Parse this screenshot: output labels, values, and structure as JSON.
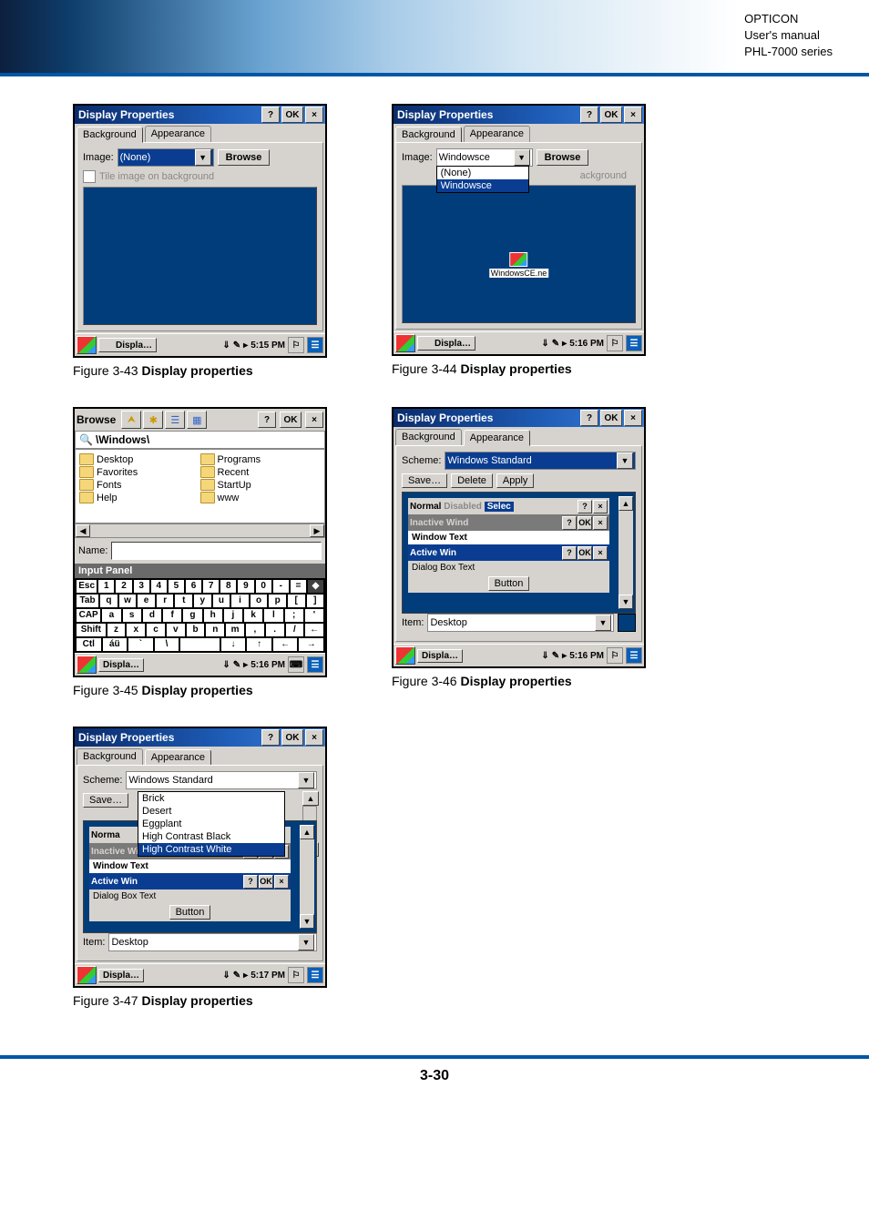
{
  "header": {
    "line1": "OPTICON",
    "line2": "User's manual",
    "line3": "PHL-7000 series"
  },
  "captions": {
    "c43_prefix": "Figure 3-43 ",
    "c43_bold": "Display properties",
    "c44_prefix": "Figure 3-44 ",
    "c44_bold": "Display properties",
    "c45_prefix": "Figure 3-45 ",
    "c45_bold": "Display properties",
    "c46_prefix": "Figure 3-46 ",
    "c46_bold": "Display properties",
    "c47_prefix": "Figure 3-47 ",
    "c47_bold": "Display properties"
  },
  "fig43": {
    "title": "Display Properties",
    "help": "?",
    "ok": "OK",
    "close": "×",
    "tabs": {
      "bg": "Background",
      "ap": "Appearance"
    },
    "image_label": "Image:",
    "image_value": "(None)",
    "browse": "Browse",
    "tile": "Tile image on background",
    "task": "Displa…",
    "time": "5:15 PM"
  },
  "fig44": {
    "title": "Display Properties",
    "help": "?",
    "ok": "OK",
    "close": "×",
    "tabs": {
      "bg": "Background",
      "ap": "Appearance"
    },
    "image_label": "Image:",
    "image_value": "Windowsce",
    "browse": "Browse",
    "dd_items": [
      "(None)",
      "Windowsce"
    ],
    "dd_overlap": "ackground",
    "desktop_icon": "WindowsCE.ne",
    "task": "Displa…",
    "time": "5:16 PM"
  },
  "fig45": {
    "browse_title": "Browse",
    "help": "?",
    "ok": "OK",
    "close": "×",
    "path": "\\Windows\\",
    "folders_left": [
      "Desktop",
      "Favorites",
      "Fonts",
      "Help"
    ],
    "folders_right": [
      "Programs",
      "Recent",
      "StartUp",
      "www"
    ],
    "name_label": "Name:",
    "ip_title": "Input Panel",
    "kbd_row1": [
      "Esc",
      "1",
      "2",
      "3",
      "4",
      "5",
      "6",
      "7",
      "8",
      "9",
      "0",
      "-",
      "=",
      "◆"
    ],
    "kbd_row2": [
      "Tab",
      "q",
      "w",
      "e",
      "r",
      "t",
      "y",
      "u",
      "i",
      "o",
      "p",
      "[",
      "]"
    ],
    "kbd_row3": [
      "CAP",
      "a",
      "s",
      "d",
      "f",
      "g",
      "h",
      "j",
      "k",
      "l",
      ";",
      "'"
    ],
    "kbd_row4": [
      "Shift",
      "z",
      "x",
      "c",
      "v",
      "b",
      "n",
      "m",
      ",",
      ".",
      "/",
      "←"
    ],
    "kbd_row5": [
      "Ctl",
      "áü",
      "`",
      "\\",
      " ",
      "↓",
      "↑",
      "←",
      "→"
    ],
    "task": "Displa…",
    "time": "5:16 PM"
  },
  "fig46": {
    "title": "Display Properties",
    "help": "?",
    "ok": "OK",
    "close": "×",
    "tabs": {
      "bg": "Background",
      "ap": "Appearance"
    },
    "scheme_label": "Scheme:",
    "scheme_value": "Windows Standard",
    "save": "Save…",
    "delete": "Delete",
    "apply": "Apply",
    "preview": {
      "normal": "Normal",
      "disabled": "Disabled",
      "selec": "Selec",
      "inactive": "Inactive Wind",
      "wtext": "Window Text",
      "active": "Active Win",
      "dlg": "Dialog Box Text",
      "btn": "Button"
    },
    "item_label": "Item:",
    "item_value": "Desktop",
    "task": "Displa…",
    "time": "5:16 PM"
  },
  "fig47": {
    "title": "Display Properties",
    "help": "?",
    "ok": "OK",
    "close": "×",
    "tabs": {
      "bg": "Background",
      "ap": "Appearance"
    },
    "scheme_label": "Scheme:",
    "scheme_value": "Windows Standard",
    "save": "Save…",
    "dd_items": [
      "Brick",
      "Desert",
      "Eggplant",
      "High Contrast Black",
      "High Contrast White"
    ],
    "preview": {
      "normal": "Norma",
      "inactive": "Inactive Wind",
      "wtext": "Window Text",
      "active": "Active Win",
      "dlg": "Dialog Box Text",
      "btn": "Button"
    },
    "item_label": "Item:",
    "item_value": "Desktop",
    "task": "Displa…",
    "time": "5:17 PM"
  },
  "footer": "3-30"
}
